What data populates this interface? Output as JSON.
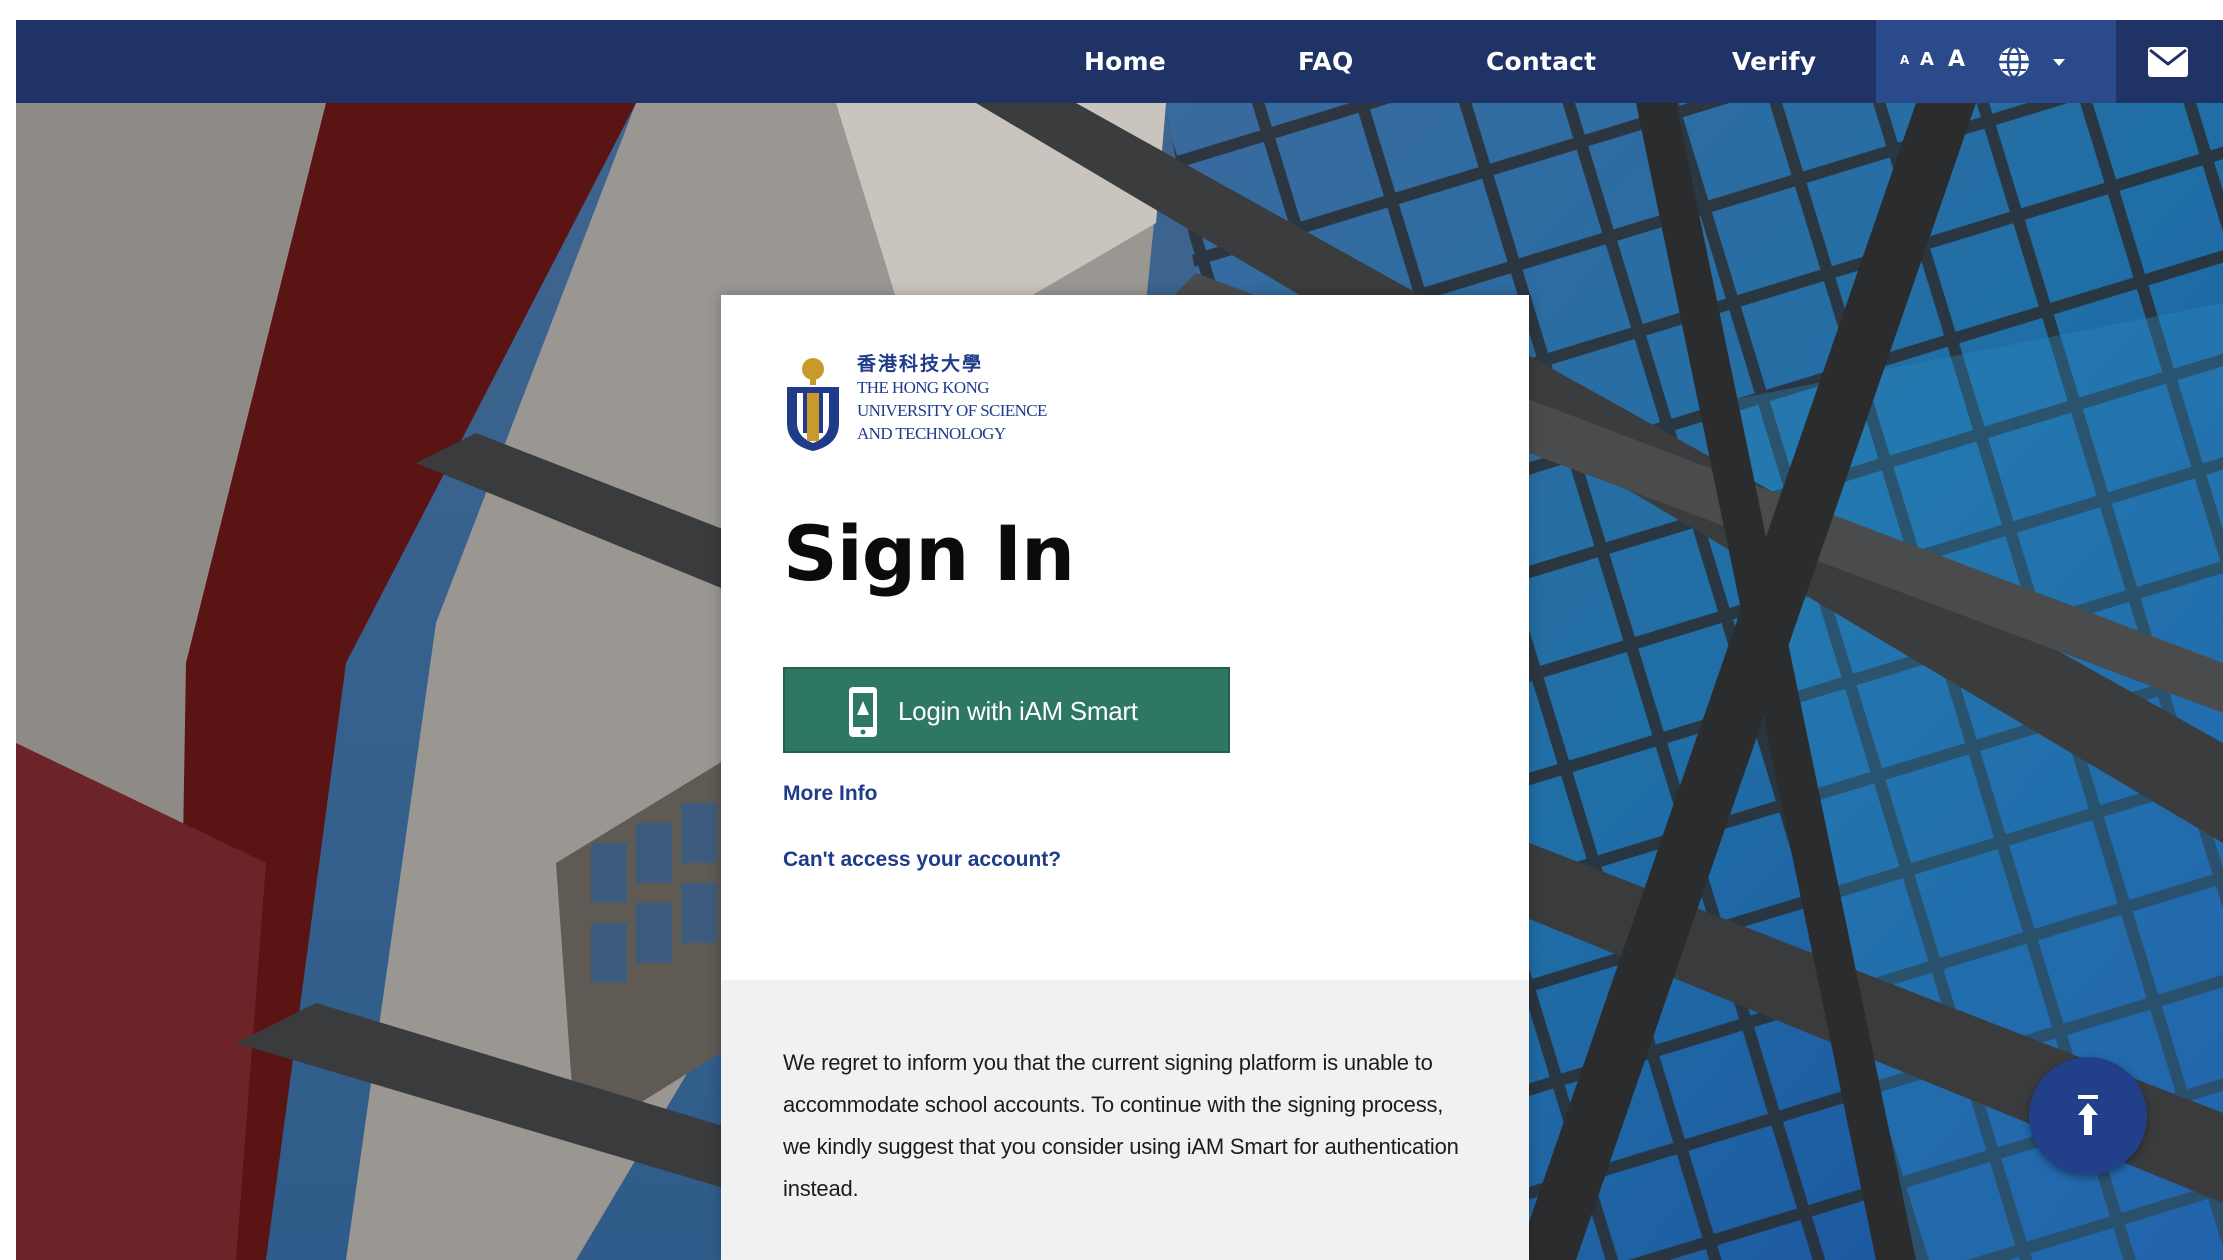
{
  "nav": {
    "links": [
      "Home",
      "FAQ",
      "Contact",
      "Verify"
    ],
    "font_size_labels": [
      "A",
      "A",
      "A"
    ],
    "language_icon": "globe-icon",
    "language_dropdown_icon": "caret-down-icon",
    "mail_icon": "envelope-icon"
  },
  "login": {
    "logo": {
      "chinese": "香港科技大學",
      "line1": "THE HONG KONG",
      "line2": "UNIVERSITY OF SCIENCE",
      "line3": "AND TECHNOLOGY"
    },
    "title": "Sign In",
    "iam_button_label": "Login with iAM Smart",
    "iam_icon": "iam-smart-phone-icon",
    "more_info": "More Info",
    "cant_access": "Can't access your account?",
    "notice": "We regret to inform you that the current signing platform is unable to accommodate school accounts. To continue with the signing process, we kindly suggest that you consider using iAM Smart for authentication instead."
  },
  "back_to_top_icon": "arrow-up-to-line-icon",
  "colors": {
    "nav_bg": "#1f3366",
    "tools_bg": "#2a4a8c",
    "iam_green": "#2f7765",
    "link_blue": "#1f3b8a",
    "notice_bg": "#f1f1f1"
  }
}
